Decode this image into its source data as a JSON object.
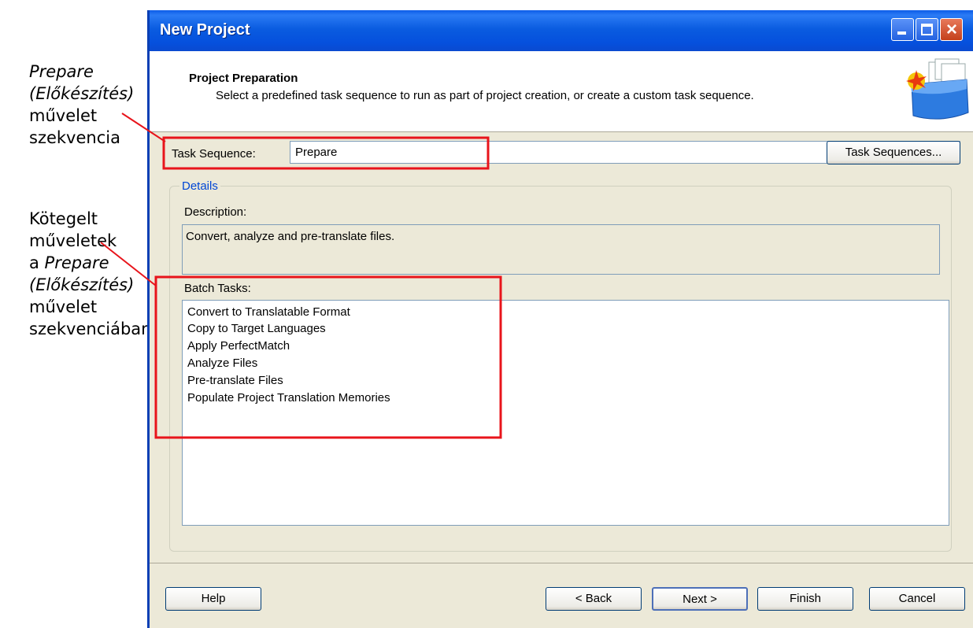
{
  "annotations": {
    "callout1": {
      "line1": "Prepare",
      "line2": "(Előkészítés)",
      "line3": "művelet",
      "line4": "szekvencia"
    },
    "callout2": {
      "line1": "Kötegelt",
      "line2": "műveletek",
      "line3_prefix": "a ",
      "line3_italic": "Prepare",
      "line4": "(Előkészítés)",
      "line5": "művelet",
      "line6": "szekvenciában"
    },
    "highlight_color": "#e8141b"
  },
  "window": {
    "title": "New Project",
    "controls": {
      "minimize": "minimize",
      "maximize": "maximize",
      "close": "×"
    }
  },
  "header": {
    "title": "Project Preparation",
    "subtitle": "Select a predefined task sequence to run as part of project creation, or create a custom task sequence."
  },
  "task_sequence": {
    "label": "Task Sequence:",
    "value": "Prepare",
    "button": "Task Sequences..."
  },
  "details": {
    "legend": "Details",
    "description_label": "Description:",
    "description_text": "Convert, analyze and pre-translate files.",
    "batch_label": "Batch Tasks:",
    "batch_tasks": [
      "Convert to Translatable Format",
      "Copy to Target Languages",
      "Apply PerfectMatch",
      "Analyze Files",
      "Pre-translate Files",
      "Populate Project Translation Memories"
    ]
  },
  "footer": {
    "help": "Help",
    "back": "< Back",
    "next": "Next >",
    "finish": "Finish",
    "cancel": "Cancel"
  }
}
